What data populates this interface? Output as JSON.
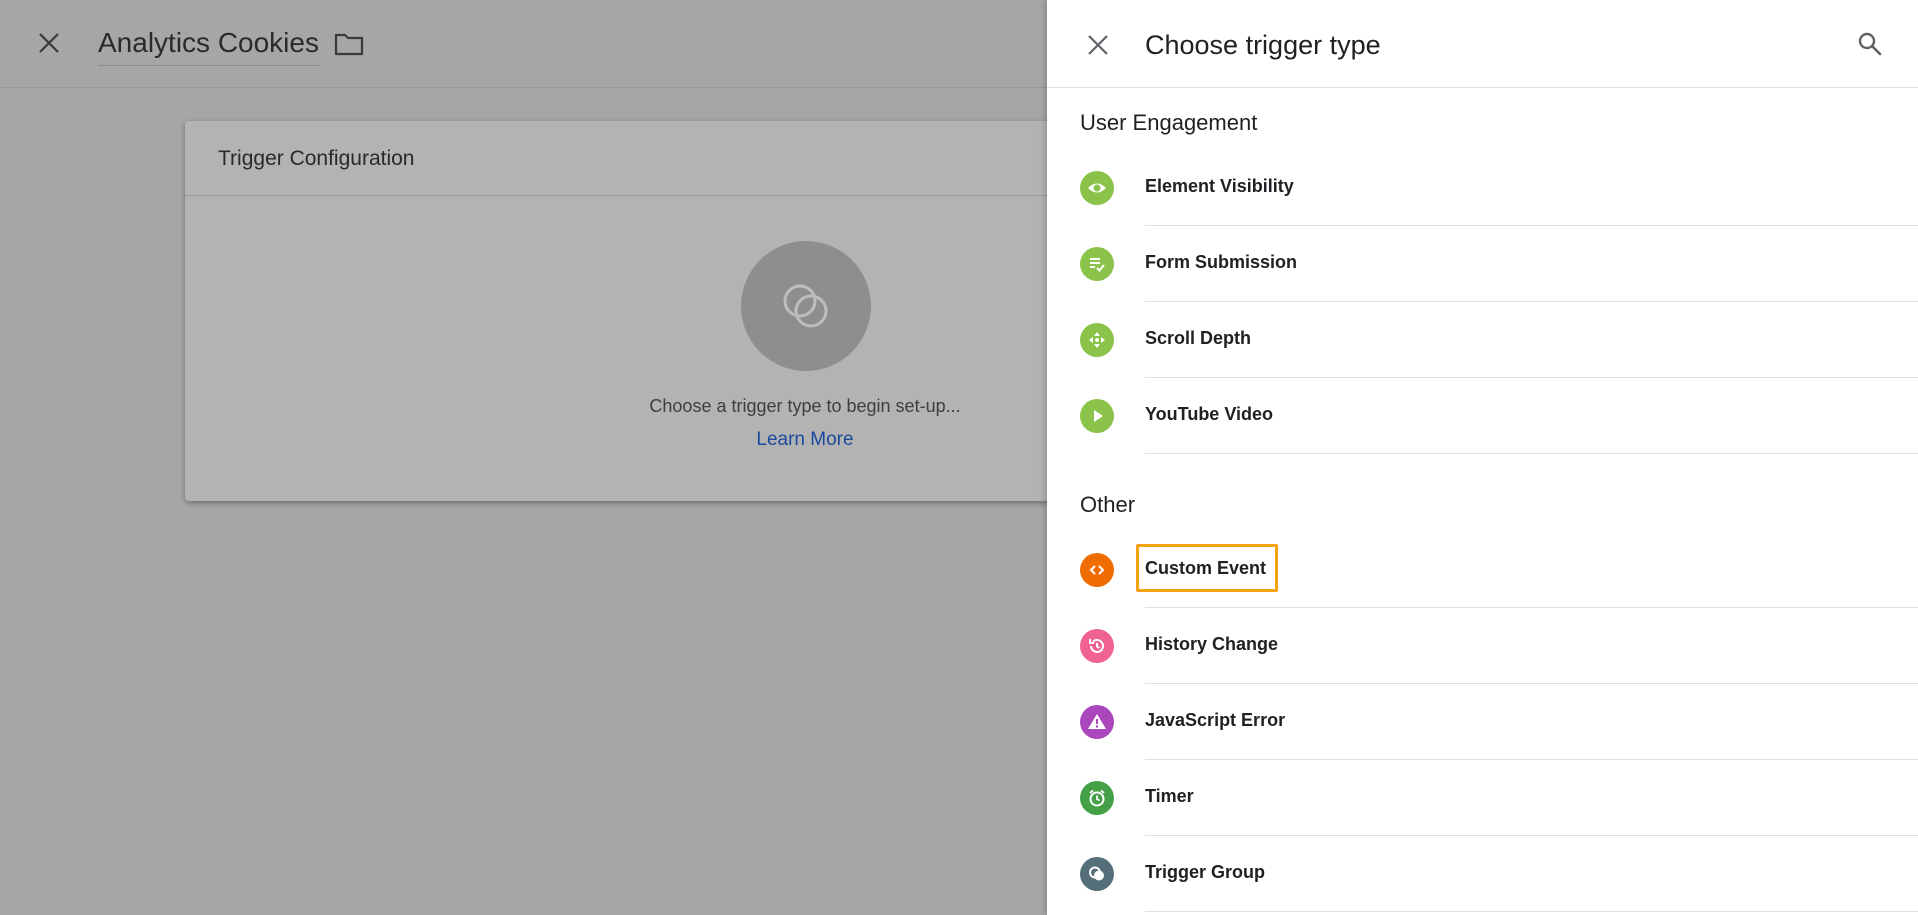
{
  "background": {
    "title": "Analytics Cookies",
    "card": {
      "header": "Trigger Configuration",
      "prompt": "Choose a trigger type to begin set-up...",
      "link": "Learn More"
    }
  },
  "drawer": {
    "title": "Choose trigger type",
    "sections": [
      {
        "title": "User Engagement",
        "items": [
          {
            "label": "Element Visibility",
            "icon": "eye-icon",
            "color": "#7cb342"
          },
          {
            "label": "Form Submission",
            "icon": "form-check-icon",
            "color": "#7cb342"
          },
          {
            "label": "Scroll Depth",
            "icon": "scroll-arrows-icon",
            "color": "#7cb342"
          },
          {
            "label": "YouTube Video",
            "icon": "play-icon",
            "color": "#7cb342"
          }
        ]
      },
      {
        "title": "Other",
        "items": [
          {
            "label": "Custom Event",
            "icon": "code-brackets-icon",
            "color": "#ef6c00",
            "highlighted": true
          },
          {
            "label": "History Change",
            "icon": "history-icon",
            "color": "#f06292"
          },
          {
            "label": "JavaScript Error",
            "icon": "warning-icon",
            "color": "#ab47bc"
          },
          {
            "label": "Timer",
            "icon": "alarm-clock-icon",
            "color": "#43a047"
          },
          {
            "label": "Trigger Group",
            "icon": "trigger-group-icon",
            "color": "#546e7a"
          }
        ]
      }
    ]
  },
  "colors": {
    "highlight": "#f5a40f",
    "link": "#1a73e8"
  }
}
